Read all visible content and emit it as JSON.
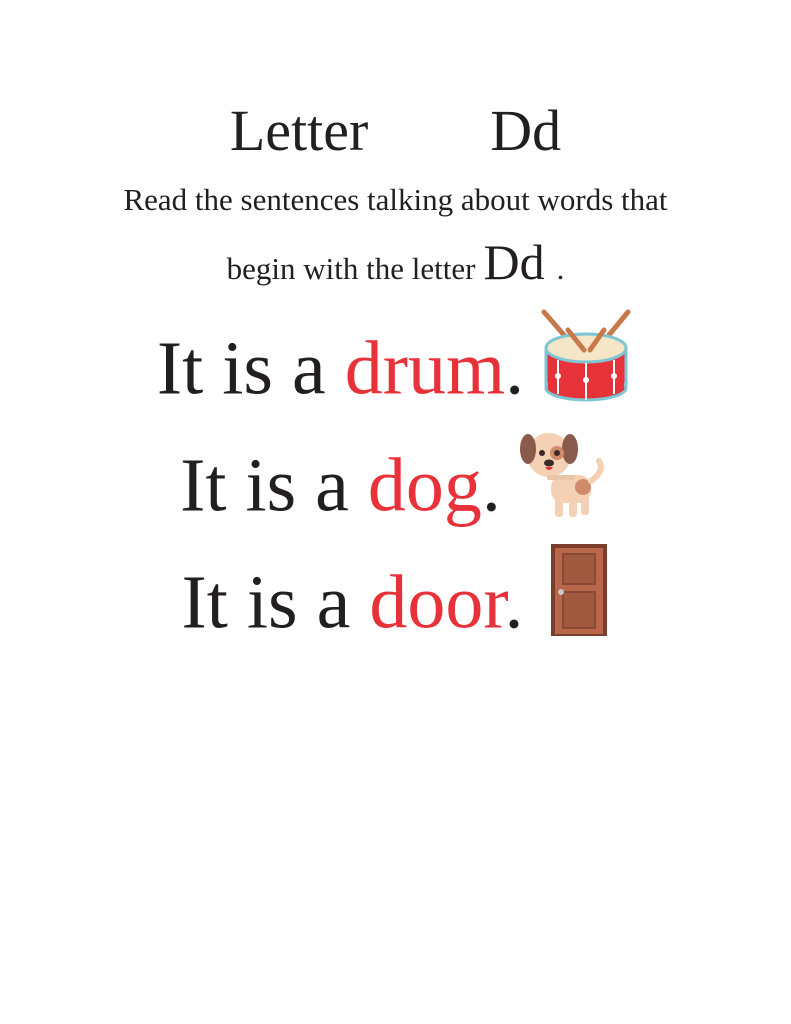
{
  "title": {
    "word": "Letter",
    "letters": "Dd"
  },
  "instructions": {
    "line1": "Read the sentences talking about words that",
    "line2": "begin with the letter",
    "letters": "Dd",
    "period": "."
  },
  "sentences": [
    {
      "prefix": "It is a ",
      "word": "drum",
      "suffix": ".",
      "icon": "drum-icon"
    },
    {
      "prefix": "It is a ",
      "word": "dog",
      "suffix": ".",
      "icon": "dog-icon"
    },
    {
      "prefix": "It is a ",
      "word": "door",
      "suffix": ".",
      "icon": "door-icon"
    }
  ],
  "colors": {
    "text": "#231f20",
    "highlight": "#e8323a"
  }
}
